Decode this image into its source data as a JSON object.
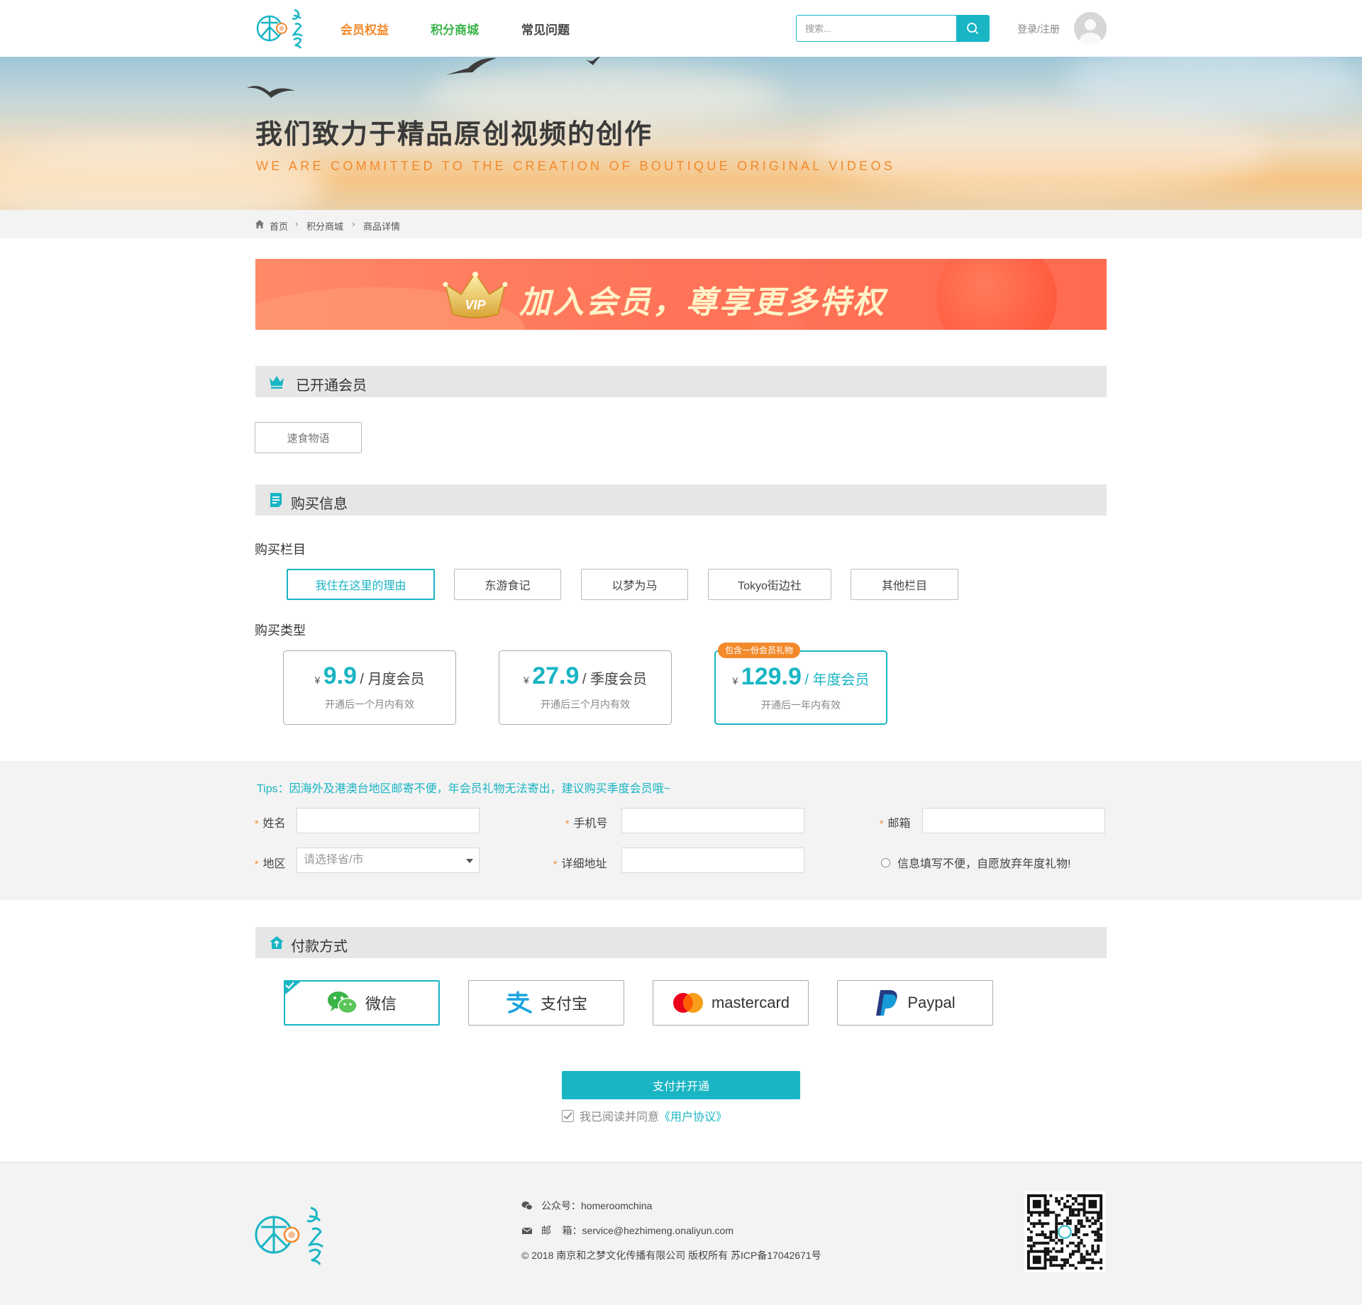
{
  "header": {
    "nav": [
      "会员权益",
      "积分商城",
      "常见问题"
    ],
    "search_placeholder": "搜索...",
    "login_label": "登录/注册"
  },
  "banner": {
    "title": "我们致力于精品原创视频的创作",
    "subtitle": "WE ARE COMMITTED TO THE CREATION OF BOUTIQUE ORIGINAL VIDEOS"
  },
  "breadcrumb": [
    "首页",
    "积分商城",
    "商品详情"
  ],
  "vip_strip": {
    "text": "加入会员，尊享更多特权",
    "crown_text": "VIP"
  },
  "opened": {
    "title": "已开通会员",
    "items": [
      "速食物语"
    ]
  },
  "purchase": {
    "title": "购买信息",
    "column_label": "购买栏目",
    "columns": [
      "我住在这里的理由",
      "东游食记",
      "以梦为马",
      "Tokyo街边社",
      "其他栏目"
    ],
    "selected_column": "我住在这里的理由",
    "type_label": "购买类型",
    "types": [
      {
        "currency": "¥",
        "price": "9.9",
        "name": "/ 月度会员",
        "desc": "开通后一个月内有效"
      },
      {
        "currency": "¥",
        "price": "27.9",
        "name": "/ 季度会员",
        "desc": "开通后三个月内有效"
      },
      {
        "currency": "¥",
        "price": "129.9",
        "name": "/ 年度会员",
        "desc": "开通后一年内有效",
        "badge": "包含一份会员礼物"
      }
    ],
    "selected_type": "年度会员"
  },
  "form": {
    "tips": "Tips：因海外及港澳台地区邮寄不便，年会员礼物无法寄出，建议购买季度会员哦~",
    "name_label": "姓名",
    "phone_label": "手机号",
    "email_label": "邮箱",
    "region_label": "地区",
    "region_placeholder": "请选择省/市",
    "address_label": "详细地址",
    "waive_label": "信息填写不便，自愿放弃年度礼物!",
    "required_mark": "*"
  },
  "payment": {
    "title": "付款方式",
    "methods": [
      "微信",
      "支付宝",
      "mastercard",
      "Paypal"
    ],
    "selected": "微信",
    "submit_label": "支付并开通",
    "agree_text": "我已阅读并同意",
    "agree_link": "《用户协议》",
    "agree_checked": true
  },
  "footer": {
    "wechat": "公众号：homeroomchina",
    "email": "邮    箱：service@hezhimeng.onaliyun.com",
    "copyright": "© 2018 南京和之梦文化传播有限公司 版权所有 苏ICP备17042671号"
  },
  "colors": {
    "accent": "#19b5c4",
    "orange": "#f28a2c",
    "green": "#3bb44a"
  },
  "icons": [
    "logo",
    "search-icon",
    "avatar-icon",
    "home-icon",
    "crown-icon",
    "document-icon",
    "wallet-icon",
    "wechat-icon",
    "alipay-icon",
    "mastercard-icon",
    "paypal-icon",
    "check-icon",
    "mail-icon",
    "qr-code"
  ]
}
